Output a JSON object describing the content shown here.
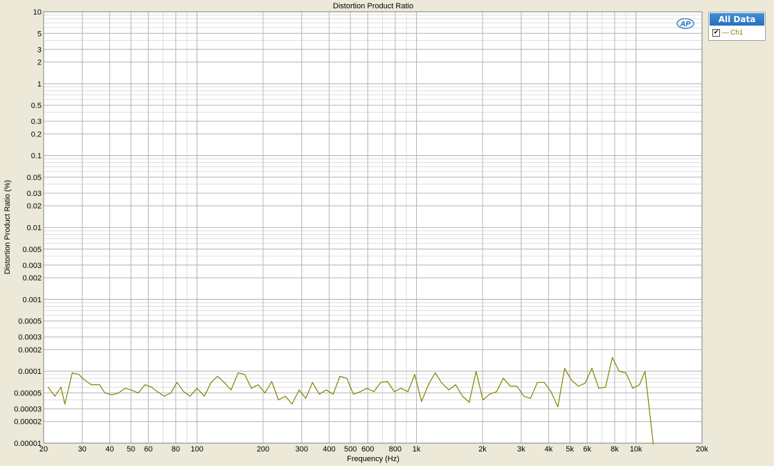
{
  "chart_data": {
    "type": "line",
    "title": "Distortion Product Ratio",
    "xlabel": "Frequency (Hz)",
    "ylabel": "Distortion Product Ratio (%)",
    "xscale": "log",
    "yscale": "log",
    "xlim": [
      20,
      20000
    ],
    "ylim": [
      1e-05,
      10
    ],
    "grid": true,
    "legend_position": "right",
    "x_ticks": [
      {
        "v": 20,
        "label": "20"
      },
      {
        "v": 30,
        "label": "30"
      },
      {
        "v": 40,
        "label": "40"
      },
      {
        "v": 50,
        "label": "50"
      },
      {
        "v": 60,
        "label": "60"
      },
      {
        "v": 80,
        "label": "80"
      },
      {
        "v": 100,
        "label": "100"
      },
      {
        "v": 200,
        "label": "200"
      },
      {
        "v": 300,
        "label": "300"
      },
      {
        "v": 400,
        "label": "400"
      },
      {
        "v": 500,
        "label": "500"
      },
      {
        "v": 600,
        "label": "600"
      },
      {
        "v": 800,
        "label": "800"
      },
      {
        "v": 1000,
        "label": "1k"
      },
      {
        "v": 2000,
        "label": "2k"
      },
      {
        "v": 3000,
        "label": "3k"
      },
      {
        "v": 4000,
        "label": "4k"
      },
      {
        "v": 5000,
        "label": "5k"
      },
      {
        "v": 6000,
        "label": "6k"
      },
      {
        "v": 8000,
        "label": "8k"
      },
      {
        "v": 10000,
        "label": "10k"
      },
      {
        "v": 20000,
        "label": "20k"
      }
    ],
    "y_ticks": [
      {
        "v": 10,
        "label": "10"
      },
      {
        "v": 5,
        "label": "5"
      },
      {
        "v": 3,
        "label": "3"
      },
      {
        "v": 2,
        "label": "2"
      },
      {
        "v": 1,
        "label": "1"
      },
      {
        "v": 0.5,
        "label": "0.5"
      },
      {
        "v": 0.3,
        "label": "0.3"
      },
      {
        "v": 0.2,
        "label": "0.2"
      },
      {
        "v": 0.1,
        "label": "0.1"
      },
      {
        "v": 0.05,
        "label": "0.05"
      },
      {
        "v": 0.03,
        "label": "0.03"
      },
      {
        "v": 0.02,
        "label": "0.02"
      },
      {
        "v": 0.01,
        "label": "0.01"
      },
      {
        "v": 0.005,
        "label": "0.005"
      },
      {
        "v": 0.003,
        "label": "0.003"
      },
      {
        "v": 0.002,
        "label": "0.002"
      },
      {
        "v": 0.001,
        "label": "0.001"
      },
      {
        "v": 0.0005,
        "label": "0.0005"
      },
      {
        "v": 0.0003,
        "label": "0.0003"
      },
      {
        "v": 0.0002,
        "label": "0.0002"
      },
      {
        "v": 0.0001,
        "label": "0.0001"
      },
      {
        "v": 5e-05,
        "label": "0.00005"
      },
      {
        "v": 3e-05,
        "label": "0.00003"
      },
      {
        "v": 2e-05,
        "label": "0.00002"
      },
      {
        "v": 1e-05,
        "label": "0.00001"
      }
    ],
    "series": [
      {
        "name": "Ch1",
        "color": "#808000",
        "x": [
          21,
          22.5,
          24,
          25,
          27,
          29,
          30,
          33,
          36,
          38,
          41,
          44,
          47,
          50,
          54,
          58,
          62,
          66,
          71,
          76,
          81,
          87,
          93,
          100,
          108,
          116,
          124,
          133,
          143,
          154,
          165,
          177,
          190,
          204,
          219,
          235,
          253,
          271,
          292,
          313,
          336,
          361,
          388,
          417,
          448,
          481,
          516,
          554,
          595,
          640,
          687,
          738,
          792,
          851,
          914,
          982,
          1055,
          1133,
          1217,
          1307,
          1404,
          1508,
          1620,
          1740,
          1869,
          2007,
          2156,
          2316,
          2487,
          2672,
          2870,
          3082,
          3311,
          3556,
          3820,
          4103,
          4407,
          4733,
          5084,
          5460,
          5865,
          6300,
          6766,
          7268,
          7806,
          8385,
          9006,
          9673,
          10390,
          11000
        ],
        "values": [
          6e-05,
          4.5e-05,
          6e-05,
          3.5e-05,
          9.5e-05,
          9e-05,
          8e-05,
          6.5e-05,
          6.5e-05,
          5e-05,
          4.7e-05,
          5e-05,
          5.8e-05,
          5.5e-05,
          5e-05,
          6.5e-05,
          6e-05,
          5.2e-05,
          4.5e-05,
          5e-05,
          7e-05,
          5.2e-05,
          4.5e-05,
          5.8e-05,
          4.5e-05,
          7e-05,
          8.5e-05,
          7e-05,
          5.5e-05,
          9.5e-05,
          9e-05,
          5.8e-05,
          6.5e-05,
          5e-05,
          7.2e-05,
          4e-05,
          4.5e-05,
          3.5e-05,
          5.5e-05,
          4.2e-05,
          7e-05,
          4.8e-05,
          5.5e-05,
          4.8e-05,
          8.5e-05,
          8e-05,
          4.8e-05,
          5.2e-05,
          5.8e-05,
          5.2e-05,
          7e-05,
          7.2e-05,
          5.2e-05,
          5.8e-05,
          5.2e-05,
          9e-05,
          3.8e-05,
          6.5e-05,
          9.5e-05,
          6.8e-05,
          5.5e-05,
          6.5e-05,
          4.5e-05,
          3.7e-05,
          0.0001,
          4e-05,
          4.8e-05,
          5.2e-05,
          8e-05,
          6.2e-05,
          6.2e-05,
          4.5e-05,
          4.2e-05,
          7e-05,
          7e-05,
          5.2e-05,
          3.2e-05,
          0.00011,
          7.5e-05,
          6.2e-05,
          6.8e-05,
          0.00011,
          5.8e-05,
          6e-05,
          0.000155,
          0.0001,
          9.5e-05,
          5.8e-05,
          6.5e-05,
          0.0001
        ]
      }
    ]
  },
  "legend": {
    "header": "All Data",
    "items": [
      {
        "label": "Ch1",
        "checked_glyph": "✔",
        "dash": "—"
      }
    ]
  },
  "colors": {
    "series": "#808000",
    "grid_major": "#b8b8b8",
    "grid_minor": "#dcdcdc",
    "plot_bg": "#ffffff",
    "frame_bg": "#ece9d8"
  },
  "logo": {
    "text": "AP",
    "color": "#1f6fbf"
  }
}
